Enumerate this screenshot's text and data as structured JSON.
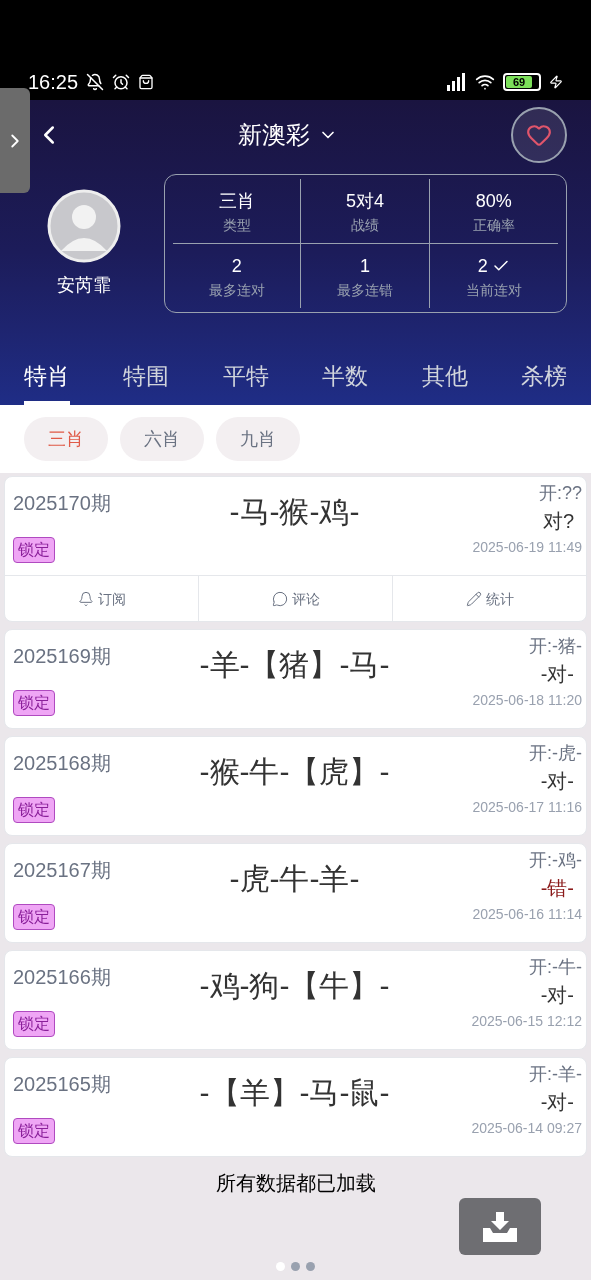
{
  "status_bar": {
    "time": "16:25",
    "battery": "69"
  },
  "header": {
    "title": "新澳彩",
    "user_name": "安芮霏",
    "favorite": false
  },
  "stats": [
    {
      "value": "三肖",
      "label": "类型",
      "checkmark": false
    },
    {
      "value": "5对4",
      "label": "战绩",
      "checkmark": false
    },
    {
      "value": "80%",
      "label": "正确率",
      "checkmark": false
    },
    {
      "value": "2",
      "label": "最多连对",
      "checkmark": false
    },
    {
      "value": "1",
      "label": "最多连错",
      "checkmark": false
    },
    {
      "value": "2",
      "label": "当前连对",
      "checkmark": true
    }
  ],
  "tabs": [
    {
      "label": "特肖",
      "selected": true
    },
    {
      "label": "特围",
      "selected": false
    },
    {
      "label": "平特",
      "selected": false
    },
    {
      "label": "半数",
      "selected": false
    },
    {
      "label": "其他",
      "selected": false
    },
    {
      "label": "杀榜",
      "selected": false
    }
  ],
  "chips": [
    {
      "label": "三肖",
      "selected": true
    },
    {
      "label": "六肖",
      "selected": false
    },
    {
      "label": "九肖",
      "selected": false
    }
  ],
  "records": [
    {
      "period": "2025170期",
      "prediction": "-马-猴-鸡-",
      "draw": "开:??",
      "result": "对?",
      "wrong": false,
      "badge": "锁定",
      "time": "2025-06-19 11:49",
      "actions": [
        {
          "kind": "bell",
          "label": "订阅"
        },
        {
          "kind": "comment",
          "label": "评论"
        },
        {
          "kind": "pencil",
          "label": "统计"
        }
      ]
    },
    {
      "period": "2025169期",
      "prediction": "-羊-【猪】-马-",
      "draw": "开:-猪-",
      "result": "-对-",
      "wrong": false,
      "badge": "锁定",
      "time": "2025-06-18 11:20"
    },
    {
      "period": "2025168期",
      "prediction": "-猴-牛-【虎】-",
      "draw": "开:-虎-",
      "result": "-对-",
      "wrong": false,
      "badge": "锁定",
      "time": "2025-06-17 11:16"
    },
    {
      "period": "2025167期",
      "prediction": "-虎-牛-羊-",
      "draw": "开:-鸡-",
      "result": "-错-",
      "wrong": true,
      "badge": "锁定",
      "time": "2025-06-16 11:14"
    },
    {
      "period": "2025166期",
      "prediction": "-鸡-狗-【牛】-",
      "draw": "开:-牛-",
      "result": "-对-",
      "wrong": false,
      "badge": "锁定",
      "time": "2025-06-15 12:12"
    },
    {
      "period": "2025165期",
      "prediction": "-【羊】-马-鼠-",
      "draw": "开:-羊-",
      "result": "-对-",
      "wrong": false,
      "badge": "锁定",
      "time": "2025-06-14 09:27"
    }
  ],
  "footer": {
    "text": "所有数据都已加载"
  },
  "page_dots": [
    {
      "selected": true
    },
    {
      "selected": false
    },
    {
      "selected": false
    }
  ]
}
